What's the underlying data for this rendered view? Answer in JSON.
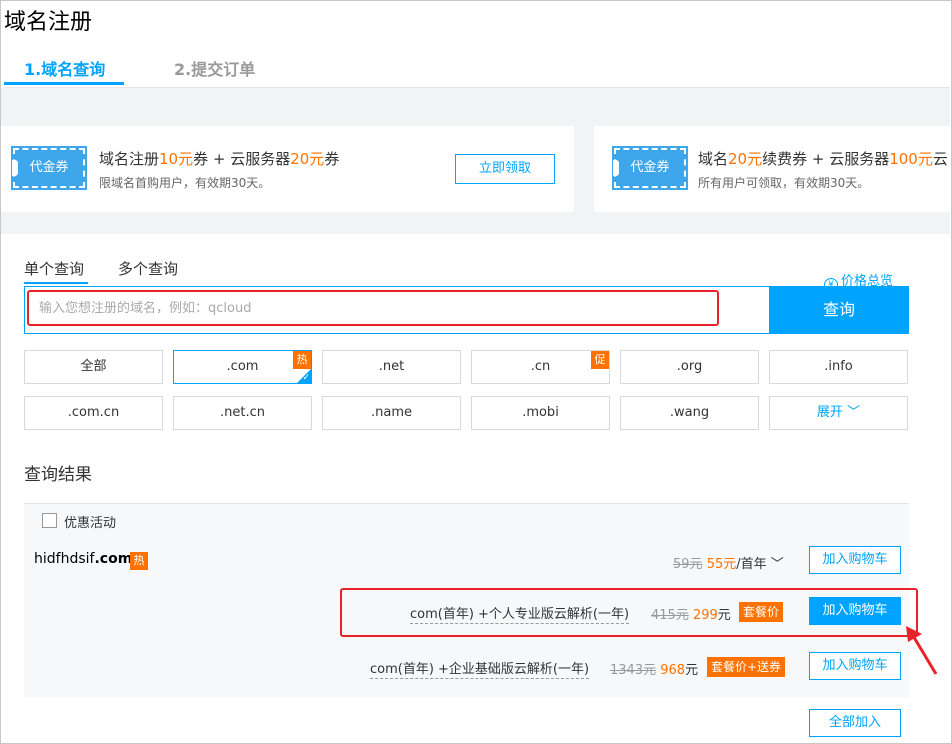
{
  "page_title": "域名注册",
  "steps": [
    {
      "label": "1.域名查询",
      "active": true
    },
    {
      "label": "2.提交订单",
      "active": false
    }
  ],
  "promos": [
    {
      "voucher_label": "代金券",
      "title_parts": [
        "域名注册",
        "10元",
        "券 + 云服务器",
        "20元",
        "券"
      ],
      "subtitle": "限域名首购用户，有效期30天。",
      "button": "立即领取"
    },
    {
      "voucher_label": "代金券",
      "title_parts": [
        "域名",
        "20元",
        "续费券 + 云服务器",
        "100元",
        "云"
      ],
      "subtitle": "所有用户可领取，有效期30天。"
    }
  ],
  "query_tabs": [
    "单个查询",
    "多个查询"
  ],
  "price_overview": "价格总览",
  "search": {
    "placeholder": "输入您想注册的域名，例如：qcloud",
    "button": "查询"
  },
  "suffixes": [
    {
      "label": "全部"
    },
    {
      "label": ".com",
      "badge": "热",
      "selected": true
    },
    {
      "label": ".net"
    },
    {
      "label": ".cn",
      "badge": "促"
    },
    {
      "label": ".org"
    },
    {
      "label": ".info"
    },
    {
      "label": ".com.cn"
    },
    {
      "label": ".net.cn"
    },
    {
      "label": ".name"
    },
    {
      "label": ".mobi"
    },
    {
      "label": ".wang"
    },
    {
      "label": "展开 ﹀"
    }
  ],
  "results": {
    "title": "查询结果",
    "promo_activity": "优惠活动",
    "domain_prefix": "hidfhdsif",
    "domain_suffix": ".com",
    "hot_badge": "热",
    "base_price": {
      "original": "59元",
      "current": "55元",
      "unit": "/首年 ﹀"
    },
    "add_to_cart": "加入购物车",
    "packages": [
      {
        "label": "com(首年) +个人专业版云解析(一年)",
        "original": "415元",
        "current": "299",
        "currency": "元",
        "tag": "套餐价",
        "button": "加入购物车"
      },
      {
        "label": "com(首年) +企业基础版云解析(一年)",
        "original": "1343元",
        "current": "968",
        "currency": "元",
        "tag": "套餐价+送券",
        "button": "加入购物车"
      }
    ],
    "add_all": "全部加入"
  },
  "colors": {
    "accent": "#00a4ff",
    "highlight": "#ff7200",
    "annotation": "#e8232a"
  }
}
